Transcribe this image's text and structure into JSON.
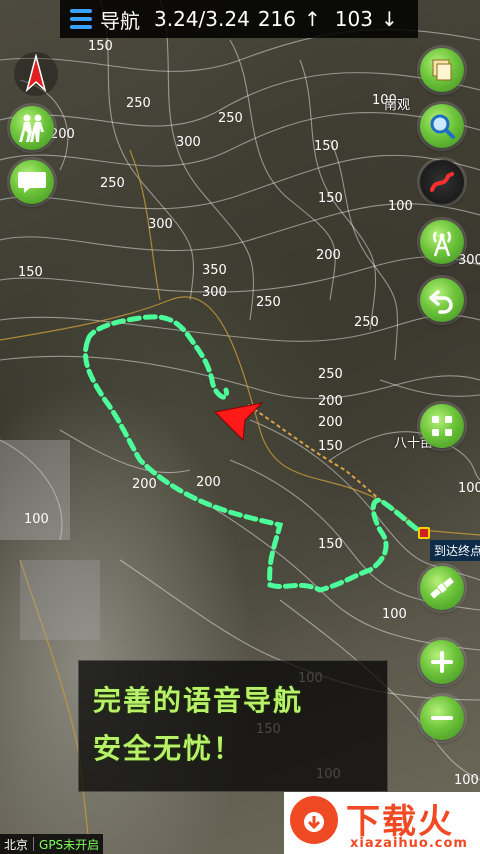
{
  "top_bar": {
    "title": "导航",
    "distance": "3.24/3.24",
    "ascent": "216",
    "ascent_arrow": "↑",
    "descent": "103",
    "descent_arrow": "↓"
  },
  "left_buttons": [
    {
      "icon": "compass-icon"
    },
    {
      "icon": "hikers-icon"
    },
    {
      "icon": "chat-bubble-icon"
    }
  ],
  "right_buttons": [
    {
      "icon": "map-layers-icon"
    },
    {
      "icon": "search-icon"
    },
    {
      "icon": "track-icon"
    },
    {
      "icon": "signal-tower-icon"
    },
    {
      "icon": "back-arrow-icon"
    },
    {
      "icon": "grid-menu-icon"
    },
    {
      "icon": "satellite-icon"
    },
    {
      "icon": "zoom-in-icon"
    },
    {
      "icon": "zoom-out-icon"
    }
  ],
  "map": {
    "contour_labels": [
      {
        "text": "150"
      },
      {
        "text": "250"
      },
      {
        "text": "250"
      },
      {
        "text": "200"
      },
      {
        "text": "300"
      },
      {
        "text": "250"
      },
      {
        "text": "300"
      },
      {
        "text": "350"
      },
      {
        "text": "300"
      },
      {
        "text": "250"
      },
      {
        "text": "150"
      },
      {
        "text": "100"
      },
      {
        "text": "150"
      },
      {
        "text": "150"
      },
      {
        "text": "100"
      },
      {
        "text": "200"
      },
      {
        "text": "250"
      },
      {
        "text": "300"
      },
      {
        "text": "250"
      },
      {
        "text": "200"
      },
      {
        "text": "200"
      },
      {
        "text": "150"
      },
      {
        "text": "200"
      },
      {
        "text": "200"
      },
      {
        "text": "100"
      },
      {
        "text": "150"
      },
      {
        "text": "100"
      },
      {
        "text": "100"
      },
      {
        "text": "100"
      },
      {
        "text": "100"
      },
      {
        "text": "150"
      },
      {
        "text": "100"
      }
    ],
    "place_names": {
      "nanguan": "南观",
      "bashimu": "八十亩地"
    },
    "destination_label": "到达终点"
  },
  "promo": {
    "line1": "完善的语音导航",
    "line2": "安全无忧！"
  },
  "logo": {
    "name": "下载火",
    "url": "xiazaihuo.com"
  },
  "status_bar": {
    "city": "北京",
    "gps": "GPS未开启"
  },
  "colors": {
    "track": "#4dff9a",
    "accent_green": "#6cc43a",
    "heading_arrow": "#ff1a1a",
    "menu_blue": "#3aa3ff",
    "logo_orange": "#f04a25"
  }
}
